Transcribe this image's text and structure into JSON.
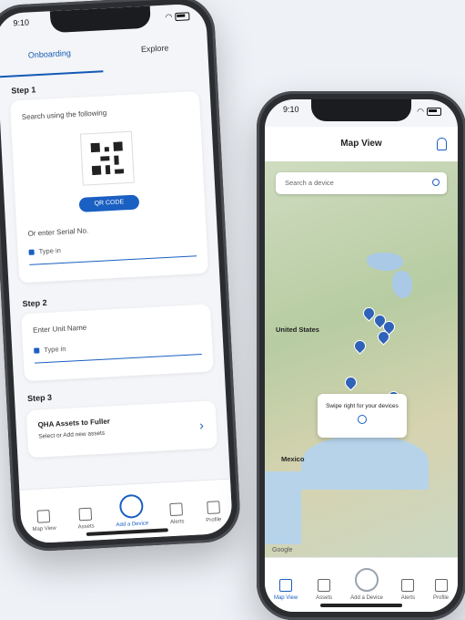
{
  "left_phone": {
    "status_time": "9:10",
    "tabs": [
      "Onboarding",
      "Explore"
    ],
    "step1": {
      "label": "Step 1",
      "instruction": "Search using the following",
      "scan_button": "QR CODE",
      "or_text": "Or enter Serial No.",
      "input_placeholder": "Type in"
    },
    "step2": {
      "label": "Step 2",
      "instruction": "Enter Unit Name",
      "input_placeholder": "Type in"
    },
    "step3": {
      "label": "Step 3",
      "card_title": "QHA Assets to Fuller",
      "card_subtitle": "Select or Add new assets"
    },
    "tabbar": [
      "Map View",
      "Assets",
      "Add a Device",
      "Alerts",
      "Profile"
    ]
  },
  "right_phone": {
    "status_time": "9:10",
    "title": "Map View",
    "search_placeholder": "Search a device",
    "map_labels": {
      "country_us": "United States",
      "country_mx": "Mexico"
    },
    "swipe_hint": "Swipe right for your devices",
    "google": "Google",
    "tabbar": [
      "Map View",
      "Assets",
      "Add a Device",
      "Alerts",
      "Profile"
    ]
  },
  "colors": {
    "accent": "#1a5fc2",
    "pin": "#2f62b8"
  },
  "icons": [
    "qr-code-icon",
    "search-icon",
    "user-icon",
    "map-pin-icon",
    "chevron-right-icon"
  ]
}
